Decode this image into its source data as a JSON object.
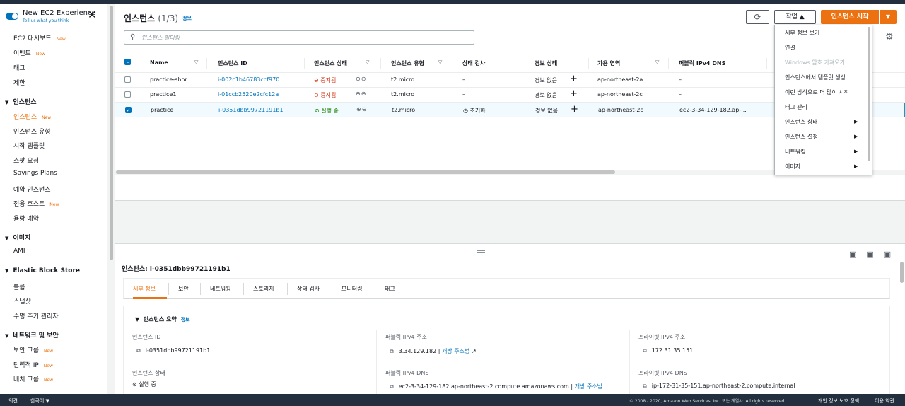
{
  "sidebar": {
    "new_experience_title": "New EC2 Experience",
    "new_experience_sub": "Tell us what you think",
    "items": [
      {
        "label": "EC2 대시보드",
        "new": "New"
      },
      {
        "label": "이벤트",
        "new": "New"
      },
      {
        "label": "태그",
        "new": ""
      },
      {
        "label": "제한",
        "new": ""
      }
    ],
    "sections": [
      {
        "title": "인스턴스",
        "items": [
          {
            "label": "인스턴스",
            "new": "New",
            "active": true
          },
          {
            "label": "인스턴스 유형",
            "new": ""
          },
          {
            "label": "시작 템플릿",
            "new": ""
          },
          {
            "label": "스팟 요청",
            "new": ""
          },
          {
            "label": "Savings Plans",
            "new": ""
          },
          {
            "label": "예약 인스턴스",
            "new": ""
          },
          {
            "label": "전용 호스트",
            "new": "New"
          },
          {
            "label": "용량 예약",
            "new": ""
          }
        ]
      },
      {
        "title": "이미지",
        "items": [
          {
            "label": "AMI",
            "new": ""
          }
        ]
      },
      {
        "title": "Elastic Block Store",
        "items": [
          {
            "label": "볼륨",
            "new": ""
          },
          {
            "label": "스냅샷",
            "new": ""
          },
          {
            "label": "수명 주기 관리자",
            "new": ""
          }
        ]
      },
      {
        "title": "네트워크 및 보안",
        "items": [
          {
            "label": "보안 그룹",
            "new": "New"
          },
          {
            "label": "탄력적 IP",
            "new": "New"
          },
          {
            "label": "배치 그룹",
            "new": "New"
          }
        ]
      }
    ]
  },
  "header": {
    "title": "인스턴스",
    "count": "(1/3)",
    "info": "정보",
    "refresh_icon": "refresh-icon",
    "action_label": "작업 ▲",
    "launch_label": "인스턴스 시작",
    "launch_dropdown": "▼",
    "search_placeholder": "인스턴스 필터링"
  },
  "table": {
    "columns": [
      "Name",
      "인스턴스 ID",
      "인스턴스 상태",
      "인스턴스 유형",
      "상태 검사",
      "경보 상태",
      "가용 영역",
      "퍼블릭 IPv4 DNS"
    ],
    "rows": [
      {
        "name": "practice-shor...",
        "id": "i-002c1b46783ccf970",
        "state": "중지됨",
        "state_kind": "stopped",
        "type": "t2.micro",
        "check": "–",
        "alarm": "경보 없음",
        "az": "ap-northeast-2a",
        "dns": "–",
        "selected": false
      },
      {
        "name": "practice1",
        "id": "i-01ccb2520e2cfc12a",
        "state": "중지됨",
        "state_kind": "stopped",
        "type": "t2.micro",
        "check": "–",
        "alarm": "경보 없음",
        "az": "ap-northeast-2c",
        "dns": "–",
        "selected": false
      },
      {
        "name": "practice",
        "id": "i-0351dbb99721191b1",
        "state": "실행 중",
        "state_kind": "running",
        "type": "t2.micro",
        "check": "초기화",
        "alarm": "경보 없음",
        "az": "ap-northeast-2c",
        "dns": "ec2-3-34-129-182.ap-...",
        "selected": true
      }
    ]
  },
  "action_menu": {
    "items": [
      {
        "label": "세부 정보 보기",
        "disabled": false,
        "submenu": false
      },
      {
        "label": "연결",
        "disabled": false,
        "submenu": false
      },
      {
        "label": "Windows 암호 가져오기",
        "disabled": true,
        "submenu": false
      },
      {
        "label": "인스턴스에서 템플릿 생성",
        "disabled": false,
        "submenu": false
      },
      {
        "label": "이런 방식으로 더 많이 시작",
        "disabled": false,
        "submenu": false
      },
      {
        "label": "태그 관리",
        "disabled": false,
        "submenu": false
      },
      {
        "label": "인스턴스 상태",
        "disabled": false,
        "submenu": true
      },
      {
        "label": "인스턴스 설정",
        "disabled": false,
        "submenu": true
      },
      {
        "label": "네트워킹",
        "disabled": false,
        "submenu": true
      },
      {
        "label": "이미지",
        "disabled": false,
        "submenu": true
      }
    ]
  },
  "detail": {
    "title": "인스턴스: i-0351dbb99721191b1",
    "tabs": [
      "세부 정보",
      "보안",
      "네트워킹",
      "스토리지",
      "상태 검사",
      "모니터링",
      "태그"
    ],
    "section_title": "인스턴스 요약",
    "section_info": "정보",
    "instance_id_label": "인스턴스 ID",
    "instance_id": "i-0351dbb99721191b1",
    "instance_state_label": "인스턴스 상태",
    "instance_state": "실행 중",
    "public_ip_label": "퍼블릭 IPv4 주소",
    "public_ip": "3.34.129.182",
    "public_ip_link": "개방 주소법",
    "public_dns_label": "퍼블릭 IPv4 DNS",
    "public_dns": "ec2-3-34-129-182.ap-northeast-2.compute.amazonaws.com",
    "public_dns_link": "개방 주소법",
    "private_ip_label": "프라이빗 IPv4 주소",
    "private_ip": "172.31.35.151",
    "private_dns_label": "프라이빗 IPv4 DNS",
    "private_dns": "ip-172-31-35-151.ap-northeast-2.compute.internal"
  },
  "footer": {
    "feedback": "의견",
    "language": "한국어",
    "copyright": "© 2008 - 2020, Amazon Web Services, Inc. 또는 계열사. All rights reserved.",
    "privacy": "개인 정보 보호 정책",
    "terms": "이용 약관"
  },
  "colors": {
    "accent": "#ec7211",
    "link": "#0073bb",
    "stopped": "#d13212",
    "running": "#1d8102",
    "nav": "#232f3e"
  }
}
